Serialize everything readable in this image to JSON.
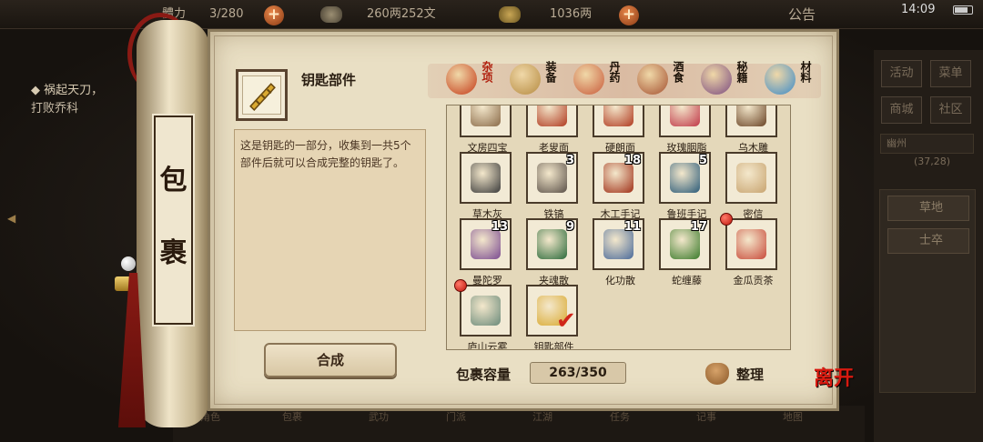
{
  "topbar": {
    "reputation_label": "體力",
    "reputation_value": "3/280",
    "silver_value": "260两252文",
    "gold_value": "1036两",
    "notice_label": "公告",
    "clock": "14:09"
  },
  "quest": {
    "title": "祸起天刀，",
    "subtitle": "打败乔科"
  },
  "side_panel": {
    "btn_activity": "活动",
    "btn_menu": "菜单",
    "btn_shop": "商城",
    "btn_community": "社区",
    "location_name": "幽州",
    "location_coords": "(37,28)",
    "list_items": [
      "草地",
      "士卒"
    ]
  },
  "bag": {
    "title_chars": [
      "包",
      "裹"
    ],
    "selected_item_name": "钥匙部件",
    "selected_item_desc": "这是钥匙的一部分，收集到一共5个部件后就可以合成完整的钥匙了。",
    "craft_button": "合成",
    "capacity_label": "包裹容量",
    "capacity_value": "263/350",
    "sort_button": "整理",
    "leave_button": "离开"
  },
  "tabs": [
    {
      "label": "杂项",
      "icon": "sundry-jar-icon",
      "active": true
    },
    {
      "label": "装备",
      "icon": "equipment-weapons-icon",
      "active": false
    },
    {
      "label": "丹药",
      "icon": "pill-plate-icon",
      "active": false
    },
    {
      "label": "酒食",
      "icon": "wine-food-icon",
      "active": false
    },
    {
      "label": "秘籍",
      "icon": "manual-books-icon",
      "active": false
    },
    {
      "label": "材料",
      "icon": "material-crystal-icon",
      "active": false
    }
  ],
  "items": [
    {
      "name": "文房四宝",
      "count": "",
      "icon": "stationery-icon"
    },
    {
      "name": "老叟面",
      "count": "",
      "icon": "mask-icon"
    },
    {
      "name": "硬朗面",
      "count": "",
      "icon": "mask-icon"
    },
    {
      "name": "玫瑰胭脂",
      "count": "",
      "icon": "rouge-icon"
    },
    {
      "name": "乌木雕",
      "count": "",
      "icon": "carving-icon"
    },
    {
      "name": "草木灰",
      "count": "",
      "icon": "ash-icon"
    },
    {
      "name": "铁镐",
      "count": "3",
      "icon": "pickaxe-icon"
    },
    {
      "name": "木工手记",
      "count": "18",
      "icon": "red-book-icon"
    },
    {
      "name": "鲁班手记",
      "count": "5",
      "icon": "blue-book-icon"
    },
    {
      "name": "密信",
      "count": "",
      "icon": "letter-icon"
    },
    {
      "name": "曼陀罗",
      "count": "13",
      "icon": "gift-box-icon"
    },
    {
      "name": "夹魂散",
      "count": "9",
      "icon": "medicine-bowl-icon"
    },
    {
      "name": "化功散",
      "count": "11",
      "icon": "vase-icon"
    },
    {
      "name": "蛇缠藤",
      "count": "17",
      "icon": "vine-icon"
    },
    {
      "name": "金瓜贡茶",
      "count": "",
      "icon": "tea-cake-icon"
    },
    {
      "name": "庐山云雾",
      "count": "",
      "icon": "tea-jar-icon"
    },
    {
      "name": "钥匙部件",
      "count": "",
      "icon": "key-part-icon"
    }
  ],
  "bottom_nav": [
    "角色",
    "包裹",
    "武功",
    "门派",
    "江湖",
    "任务",
    "记事",
    "地图"
  ],
  "colors": {
    "active_tab": "#b0200e",
    "red_dot": "#c0160c",
    "paper": "#e9dfc4"
  }
}
